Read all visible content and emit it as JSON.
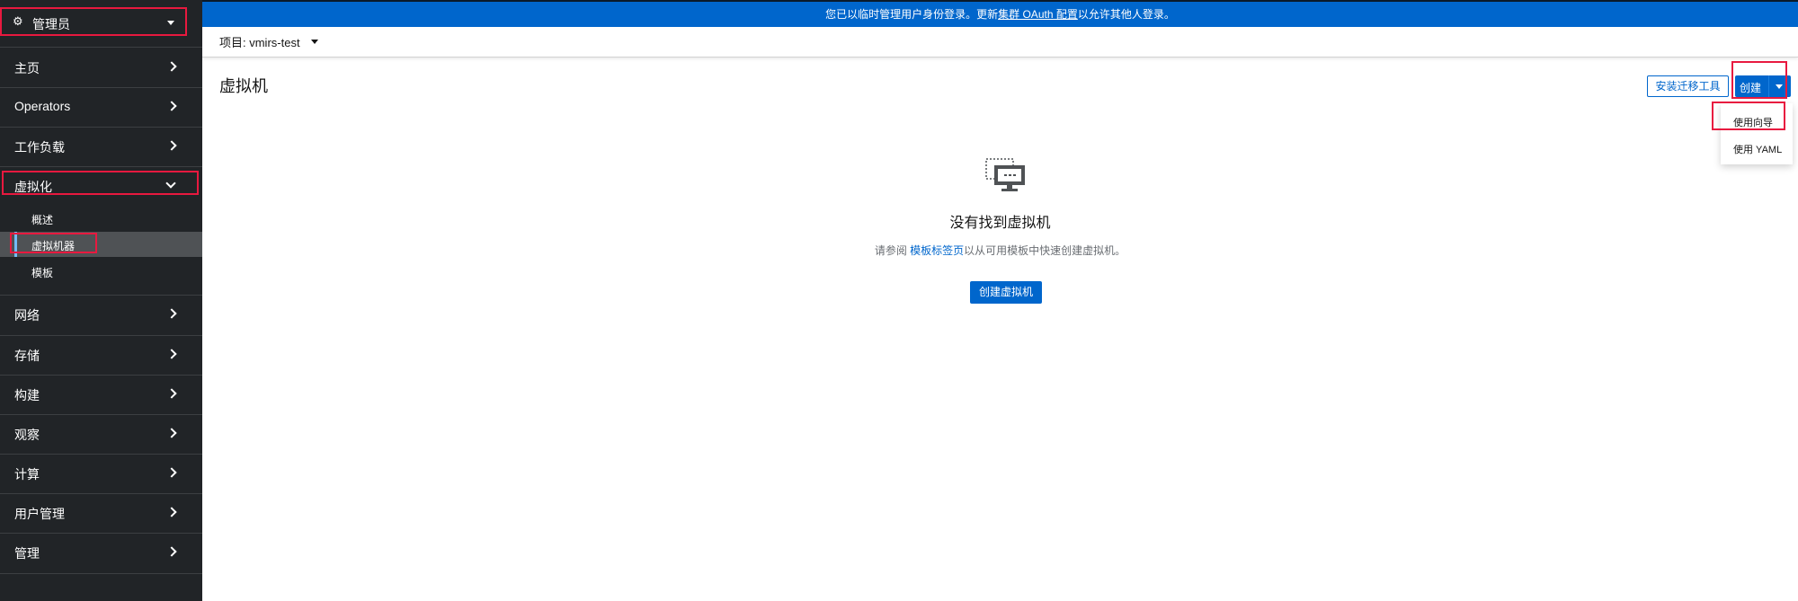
{
  "sidebar": {
    "perspective": {
      "icon": "gears-icon",
      "label": "管理员"
    },
    "items": [
      {
        "label": "主页",
        "expanded": false
      },
      {
        "label": "Operators",
        "expanded": false
      },
      {
        "label": "工作负载",
        "expanded": false
      },
      {
        "label": "虚拟化",
        "expanded": true
      },
      {
        "label": "网络",
        "expanded": false
      },
      {
        "label": "存储",
        "expanded": false
      },
      {
        "label": "构建",
        "expanded": false
      },
      {
        "label": "观察",
        "expanded": false
      },
      {
        "label": "计算",
        "expanded": false
      },
      {
        "label": "用户管理",
        "expanded": false
      },
      {
        "label": "管理",
        "expanded": false
      }
    ],
    "virtualization_subitems": [
      {
        "label": "概述",
        "active": false
      },
      {
        "label": "虚拟机器",
        "active": true
      },
      {
        "label": "模板",
        "active": false
      }
    ]
  },
  "banner": {
    "text_before": "您已以临时管理用户身份登录。更新",
    "link": "集群 OAuth 配置",
    "text_after": "以允许其他人登录。"
  },
  "project": {
    "label": "项目: vmirs-test"
  },
  "page": {
    "title": "虚拟机",
    "install_button": "安装迁移工具",
    "create_button": "创建",
    "create_menu": [
      "使用向导",
      "使用 YAML"
    ]
  },
  "empty_state": {
    "icon": "virtual-machine-icon",
    "title": "没有找到虚拟机",
    "body_before": "请参阅 ",
    "body_link": "模板标签页",
    "body_after": "以从可用模板中快速创建虚拟机。",
    "button": "创建虚拟机"
  },
  "colors": {
    "sidebar_bg": "#212427",
    "accent": "#0066cc",
    "highlight": "#e8193f"
  }
}
